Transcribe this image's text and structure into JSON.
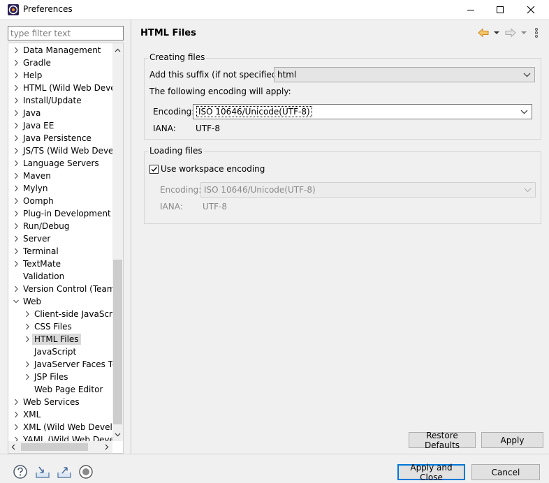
{
  "window": {
    "title": "Preferences"
  },
  "filter": {
    "placeholder": "type filter text"
  },
  "tree": [
    {
      "label": "Data Management",
      "level": 0,
      "twisty": "collapsed"
    },
    {
      "label": "Gradle",
      "level": 0,
      "twisty": "collapsed"
    },
    {
      "label": "Help",
      "level": 0,
      "twisty": "collapsed"
    },
    {
      "label": "HTML (Wild Web Develo",
      "level": 0,
      "twisty": "collapsed"
    },
    {
      "label": "Install/Update",
      "level": 0,
      "twisty": "collapsed"
    },
    {
      "label": "Java",
      "level": 0,
      "twisty": "collapsed"
    },
    {
      "label": "Java EE",
      "level": 0,
      "twisty": "collapsed"
    },
    {
      "label": "Java Persistence",
      "level": 0,
      "twisty": "collapsed"
    },
    {
      "label": "JS/TS (Wild Web Develo",
      "level": 0,
      "twisty": "collapsed"
    },
    {
      "label": "Language Servers",
      "level": 0,
      "twisty": "collapsed"
    },
    {
      "label": "Maven",
      "level": 0,
      "twisty": "collapsed"
    },
    {
      "label": "Mylyn",
      "level": 0,
      "twisty": "collapsed"
    },
    {
      "label": "Oomph",
      "level": 0,
      "twisty": "collapsed"
    },
    {
      "label": "Plug-in Development",
      "level": 0,
      "twisty": "collapsed"
    },
    {
      "label": "Run/Debug",
      "level": 0,
      "twisty": "collapsed"
    },
    {
      "label": "Server",
      "level": 0,
      "twisty": "collapsed"
    },
    {
      "label": "Terminal",
      "level": 0,
      "twisty": "collapsed"
    },
    {
      "label": "TextMate",
      "level": 0,
      "twisty": "collapsed"
    },
    {
      "label": "Validation",
      "level": 0,
      "twisty": "none"
    },
    {
      "label": "Version Control (Team)",
      "level": 0,
      "twisty": "collapsed"
    },
    {
      "label": "Web",
      "level": 0,
      "twisty": "expanded"
    },
    {
      "label": "Client-side JavaScript",
      "level": 1,
      "twisty": "collapsed"
    },
    {
      "label": "CSS Files",
      "level": 1,
      "twisty": "collapsed"
    },
    {
      "label": "HTML Files",
      "level": 1,
      "twisty": "collapsed",
      "selected": true
    },
    {
      "label": "JavaScript",
      "level": 1,
      "twisty": "none"
    },
    {
      "label": "JavaServer Faces Tools",
      "level": 1,
      "twisty": "collapsed"
    },
    {
      "label": "JSP Files",
      "level": 1,
      "twisty": "collapsed"
    },
    {
      "label": "Web Page Editor",
      "level": 1,
      "twisty": "none"
    },
    {
      "label": "Web Services",
      "level": 0,
      "twisty": "collapsed"
    },
    {
      "label": "XML",
      "level": 0,
      "twisty": "collapsed"
    },
    {
      "label": "XML (Wild Web Develop",
      "level": 0,
      "twisty": "collapsed"
    },
    {
      "label": "YAML (Wild Web Develo",
      "level": 0,
      "twisty": "collapsed"
    }
  ],
  "page": {
    "title": "HTML Files",
    "creating": {
      "group_title": "Creating files",
      "suffix_label": "Add this suffix (if not specified):",
      "suffix_value": "html",
      "encoding_note": "The following encoding will apply:",
      "encoding_label": "Encoding:",
      "encoding_value": "ISO 10646/Unicode(UTF-8)",
      "iana_label": "IANA:",
      "iana_value": "UTF-8"
    },
    "loading": {
      "group_title": "Loading files",
      "use_workspace_label": "Use workspace encoding",
      "use_workspace_checked": true,
      "encoding_label": "Encoding:",
      "encoding_value": "ISO 10646/Unicode(UTF-8)",
      "iana_label": "IANA:",
      "iana_value": "UTF-8"
    }
  },
  "buttons": {
    "restore_defaults": "Restore Defaults",
    "apply": "Apply",
    "apply_and_close": "Apply and Close",
    "cancel": "Cancel"
  },
  "icons": {
    "app": "eclipse-icon",
    "help": "help-icon",
    "import": "import-icon",
    "export": "export-icon",
    "oomph": "record-icon",
    "back": "back-arrow-icon",
    "forward": "forward-arrow-icon",
    "view_menu": "view-menu-icon"
  },
  "colors": {
    "focus_border": "#0078d7",
    "back_arrow": "#e8a63a"
  }
}
